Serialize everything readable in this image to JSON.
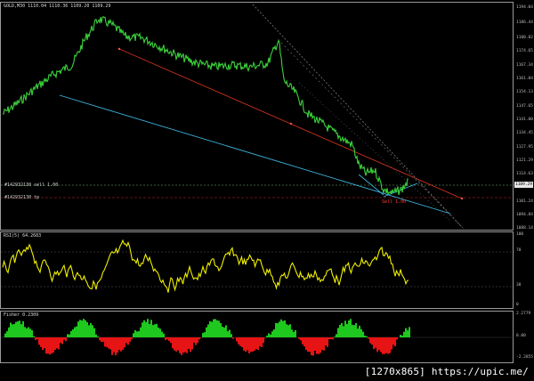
{
  "main": {
    "title": "GOLD,M30  1110.04  1110.36  1109.20  1109.29",
    "trade_labels": [
      "#142932130 sell 1.00",
      "#142932130 tp"
    ],
    "order_tag": "Sell 1.00",
    "axis_ticks": [
      "1194.04",
      "1186.44",
      "1180.82",
      "1174.65",
      "1167.34",
      "1161.04",
      "1154.13",
      "1147.65",
      "1141.00",
      "1134.45",
      "1127.95",
      "1121.29",
      "1114.63",
      "1109.29",
      "1101.24",
      "1094.84",
      "1088.14"
    ],
    "current_price": "1109.29"
  },
  "rsi": {
    "title": "RSI(5) 64.2683",
    "axis_ticks": [
      "100",
      "70",
      "30",
      "0"
    ]
  },
  "fisher": {
    "title": "Fisher 0.2309",
    "axis_ticks": [
      "2.2779",
      "0.00",
      "-2.2855"
    ]
  },
  "watermark": "[1270x865] https://upic.me/",
  "colors": {
    "price": "#3cd23c",
    "channel_cyan": "#3cb4dc",
    "channel_red": "#c8321e",
    "rsi": "#f0f000",
    "fisher_pos": "#1ec81e",
    "fisher_neg": "#e61414"
  }
}
